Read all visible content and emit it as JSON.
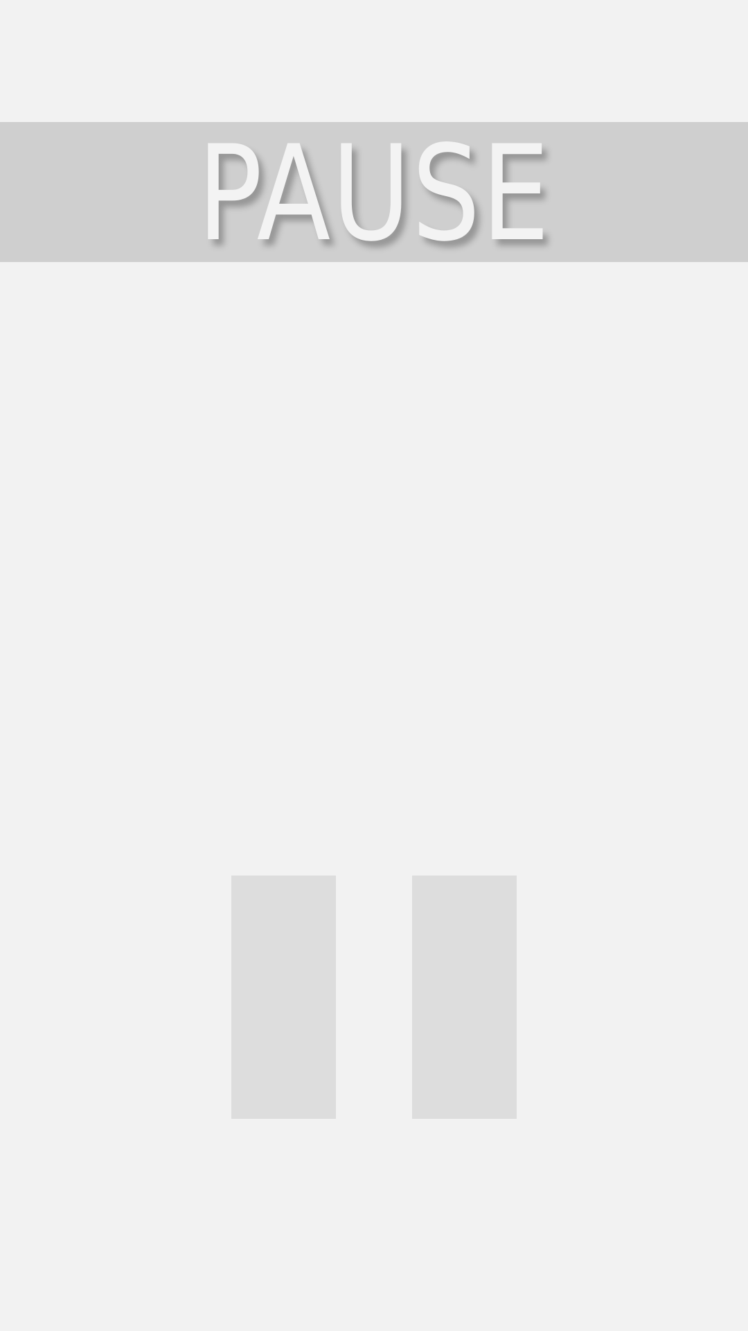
{
  "screen": {
    "name": "pause-screen",
    "background_color": "#f2f2f2"
  },
  "banner": {
    "title": "PAUSE",
    "background_color": "#cfcfcf",
    "text_color": "#f3f3f3"
  },
  "pause_icon": {
    "icon": "pause-icon",
    "bar_color": "#dddddd"
  }
}
